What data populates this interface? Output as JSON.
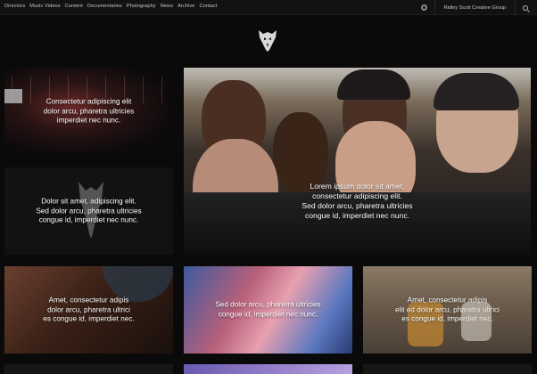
{
  "nav": {
    "links": [
      "Directors",
      "Music Videos",
      "Content",
      "Documentaries",
      "Photography",
      "News",
      "Archive",
      "Contact"
    ],
    "group_link": "Ridley Scott Creative Group"
  },
  "tiles": [
    {
      "lines": [
        "Consectetur adipiscing elit",
        "dolor arcu, pharetra ultricies",
        "imperdiet nec nunc."
      ]
    },
    {
      "lines": [
        "Dolor sit amet, adipiscing elit.",
        "Sed dolor arcu, pharetra ultricies",
        "congue id, imperdiet nec nunc."
      ]
    },
    {
      "lines": [
        "Lorem ipsum dolor sit amet,",
        "consectetur adipiscing elit.",
        "Sed dolor arcu, pharetra ultricies",
        "congue id, imperdiet nec nunc."
      ]
    },
    {
      "lines": [
        "Amet, consectetur adipis",
        "dolor arcu, pharetra ultrici",
        "es congue id, imperdiet nec."
      ]
    },
    {
      "lines": [
        "Sed dolor arcu, pharetra ultricies",
        "congue id, imperdiet nec nunc."
      ]
    },
    {
      "lines": [
        "Amet, consectetur adipis",
        "elit ed dolor arcu, pharetra ultrici",
        "es congue id, imperdiet nec."
      ]
    }
  ]
}
